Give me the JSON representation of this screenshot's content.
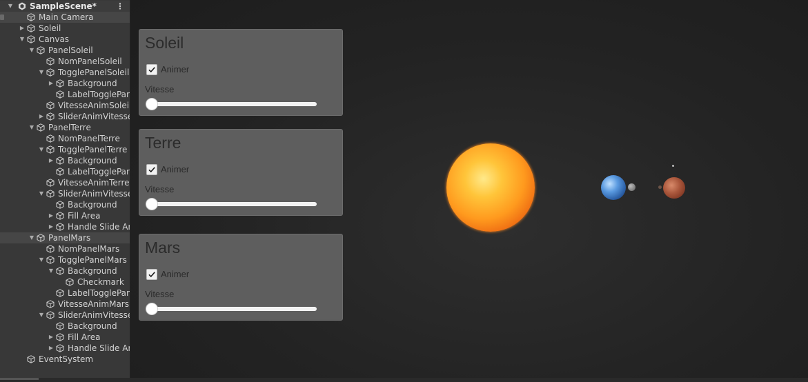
{
  "hierarchy": {
    "scene_name": "SampleScene*",
    "items": [
      {
        "label": "Main Camera",
        "depth": 1,
        "arrow": "",
        "selected": false,
        "highlight": true
      },
      {
        "label": "Soleil",
        "depth": 1,
        "arrow": "right"
      },
      {
        "label": "Canvas",
        "depth": 1,
        "arrow": "down"
      },
      {
        "label": "PanelSoleil",
        "depth": 2,
        "arrow": "down"
      },
      {
        "label": "NomPanelSoleil",
        "depth": 3,
        "arrow": ""
      },
      {
        "label": "TogglePanelSoleil",
        "depth": 3,
        "arrow": "down"
      },
      {
        "label": "Background",
        "depth": 4,
        "arrow": "right"
      },
      {
        "label": "LabelTogglePar",
        "depth": 4,
        "arrow": ""
      },
      {
        "label": "VitesseAnimSoleil",
        "depth": 3,
        "arrow": ""
      },
      {
        "label": "SliderAnimVitesseS",
        "depth": 3,
        "arrow": "right"
      },
      {
        "label": "PanelTerre",
        "depth": 2,
        "arrow": "down"
      },
      {
        "label": "NomPanelTerre",
        "depth": 3,
        "arrow": ""
      },
      {
        "label": "TogglePanelTerre",
        "depth": 3,
        "arrow": "down"
      },
      {
        "label": "Background",
        "depth": 4,
        "arrow": "right"
      },
      {
        "label": "LabelTogglePar",
        "depth": 4,
        "arrow": ""
      },
      {
        "label": "VitesseAnimTerre",
        "depth": 3,
        "arrow": ""
      },
      {
        "label": "SliderAnimVitesseT",
        "depth": 3,
        "arrow": "down"
      },
      {
        "label": "Background",
        "depth": 4,
        "arrow": ""
      },
      {
        "label": "Fill Area",
        "depth": 4,
        "arrow": "right"
      },
      {
        "label": "Handle Slide Are",
        "depth": 4,
        "arrow": "right"
      },
      {
        "label": "PanelMars",
        "depth": 2,
        "arrow": "down",
        "selected": true
      },
      {
        "label": "NomPanelMars",
        "depth": 3,
        "arrow": ""
      },
      {
        "label": "TogglePanelMars",
        "depth": 3,
        "arrow": "down"
      },
      {
        "label": "Background",
        "depth": 4,
        "arrow": "down"
      },
      {
        "label": "Checkmark",
        "depth": 5,
        "arrow": ""
      },
      {
        "label": "LabelTogglePar",
        "depth": 4,
        "arrow": ""
      },
      {
        "label": "VitesseAnimMars",
        "depth": 3,
        "arrow": ""
      },
      {
        "label": "SliderAnimVitesseI",
        "depth": 3,
        "arrow": "down"
      },
      {
        "label": "Background",
        "depth": 4,
        "arrow": ""
      },
      {
        "label": "Fill Area",
        "depth": 4,
        "arrow": "right"
      },
      {
        "label": "Handle Slide Are",
        "depth": 4,
        "arrow": "right"
      },
      {
        "label": "EventSystem",
        "depth": 1,
        "arrow": ""
      }
    ]
  },
  "panels": [
    {
      "title": "Soleil",
      "toggle_label": "Animer",
      "checked": true,
      "slider_label": "Vitesse",
      "slider_value": 0
    },
    {
      "title": "Terre",
      "toggle_label": "Animer",
      "checked": true,
      "slider_label": "Vitesse",
      "slider_value": 0
    },
    {
      "title": "Mars",
      "toggle_label": "Animer",
      "checked": true,
      "slider_label": "Vitesse",
      "slider_value": 0
    }
  ],
  "icons": {
    "scene": "unity-scene-icon",
    "gameobject": "cube-icon",
    "menu": "kebab-menu-icon",
    "checkmark": "checkmark-icon"
  },
  "colors": {
    "hierarchy_bg": "#383838",
    "selection_bg": "#464646",
    "panel_bg": "#5e5e5e",
    "game_bg": "#232323"
  }
}
